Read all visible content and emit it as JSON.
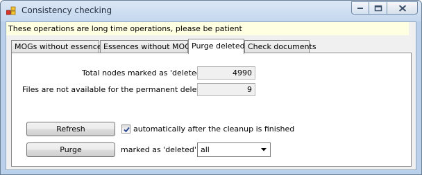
{
  "window": {
    "title": "Consistency checking",
    "icon": "app-icon"
  },
  "banner": {
    "text": "These operations are long time operations, please be patient"
  },
  "tabs": [
    {
      "label": "MOGs without essences",
      "active": false
    },
    {
      "label": "Essences without MOGs",
      "active": false
    },
    {
      "label": "Purge deleted",
      "active": true
    },
    {
      "label": "Check documents",
      "active": false
    }
  ],
  "purge": {
    "total_label": "Total nodes marked as 'deleted':",
    "total_value": "4990",
    "files_label": "Files are not available for the permanent deletion:",
    "files_value": "9",
    "refresh_label": "Refresh",
    "auto_checked": true,
    "auto_label": "automatically after the cleanup is finished",
    "purge_label": "Purge",
    "marked_label": "marked as 'deleted'",
    "filter_value": "all"
  },
  "colors": {
    "banner_bg": "#ffffe1",
    "frame": "#b9d1ea"
  }
}
